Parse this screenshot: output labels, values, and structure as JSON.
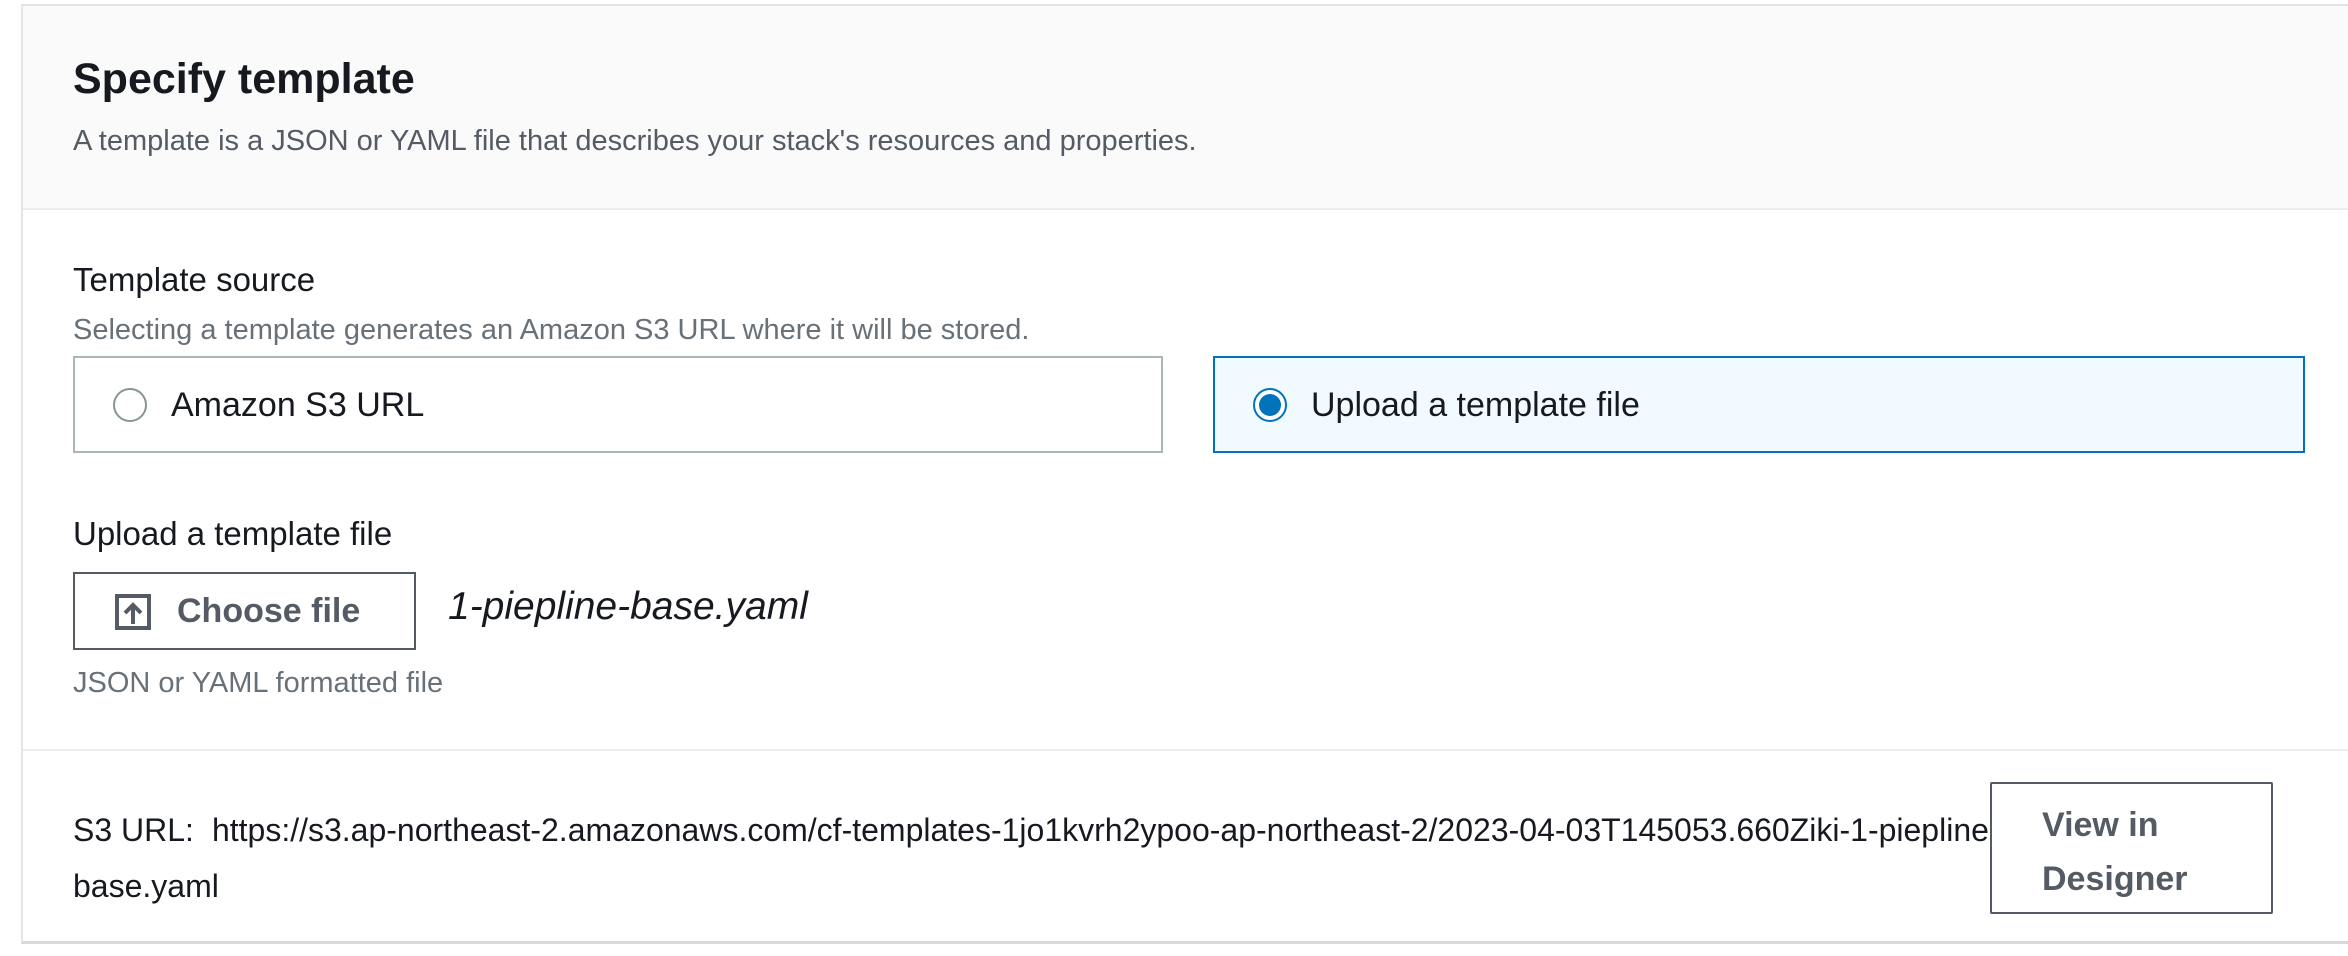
{
  "header": {
    "title": "Specify template",
    "description": "A template is a JSON or YAML file that describes your stack's resources and properties."
  },
  "template_source": {
    "label": "Template source",
    "hint": "Selecting a template generates an Amazon S3 URL where it will be stored.",
    "options": [
      {
        "label": "Amazon S3 URL",
        "selected": false
      },
      {
        "label": "Upload a template file",
        "selected": true
      }
    ]
  },
  "upload": {
    "label": "Upload a template file",
    "button_label": "Choose file",
    "button_icon": "upload-icon",
    "file_name": "1-piepline-base.yaml",
    "hint": "JSON or YAML formatted file"
  },
  "s3": {
    "key_label": "S3 URL:",
    "url": "https://s3.ap-northeast-2.amazonaws.com/cf-templates-1jo1kvrh2ypoo-ap-northeast-2/2023-04-03T145053.660Ziki-1-piepline-base.yaml",
    "designer_button_label": "View in Designer"
  },
  "colors": {
    "accent": "#0073bb",
    "selected_tile_background": "#f1faff",
    "text_primary": "#16191f",
    "text_secondary": "#687078"
  }
}
